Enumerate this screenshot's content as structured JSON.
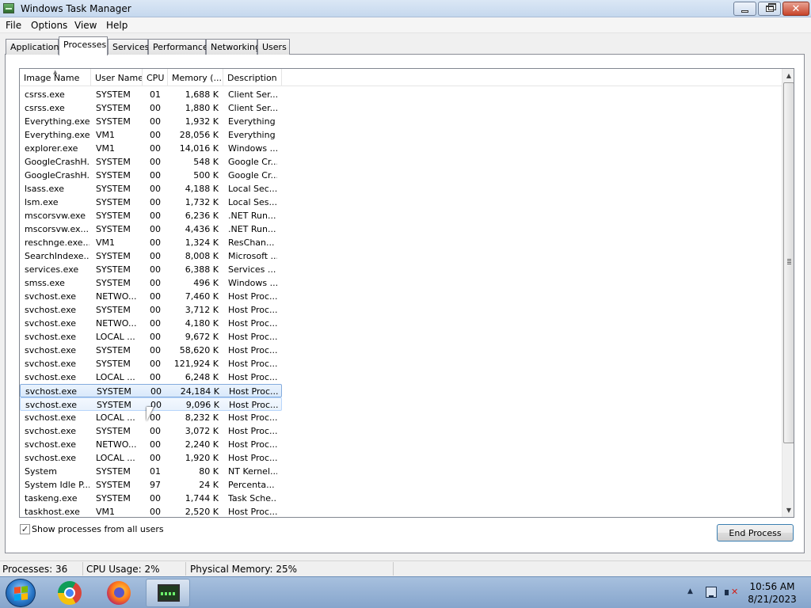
{
  "window": {
    "title": "Windows Task Manager",
    "controls": {
      "minimize": "minimize",
      "maximize": "maximize",
      "close": "✕"
    }
  },
  "menu": [
    "File",
    "Options",
    "View",
    "Help"
  ],
  "tabs": [
    {
      "label": "Applications",
      "active": false
    },
    {
      "label": "Processes",
      "active": true
    },
    {
      "label": "Services",
      "active": false
    },
    {
      "label": "Performance",
      "active": false
    },
    {
      "label": "Networking",
      "active": false
    },
    {
      "label": "Users",
      "active": false
    }
  ],
  "table": {
    "columns": [
      "Image Name",
      "User Name",
      "CPU",
      "Memory (...",
      "Description"
    ],
    "sort_column": "Image Name",
    "rows": [
      [
        "csrss.exe",
        "SYSTEM",
        "01",
        "1,688 K",
        "Client Ser..."
      ],
      [
        "csrss.exe",
        "SYSTEM",
        "00",
        "1,880 K",
        "Client Ser..."
      ],
      [
        "Everything.exe",
        "SYSTEM",
        "00",
        "1,932 K",
        "Everything"
      ],
      [
        "Everything.exe",
        "VM1",
        "00",
        "28,056 K",
        "Everything"
      ],
      [
        "explorer.exe",
        "VM1",
        "00",
        "14,016 K",
        "Windows ..."
      ],
      [
        "GoogleCrashH...",
        "SYSTEM",
        "00",
        "548 K",
        "Google Cr..."
      ],
      [
        "GoogleCrashH...",
        "SYSTEM",
        "00",
        "500 K",
        "Google Cr..."
      ],
      [
        "lsass.exe",
        "SYSTEM",
        "00",
        "4,188 K",
        "Local Sec..."
      ],
      [
        "lsm.exe",
        "SYSTEM",
        "00",
        "1,732 K",
        "Local Ses..."
      ],
      [
        "mscorsvw.exe",
        "SYSTEM",
        "00",
        "6,236 K",
        ".NET Run..."
      ],
      [
        "mscorsvw.ex...",
        "SYSTEM",
        "00",
        "4,436 K",
        ".NET Run..."
      ],
      [
        "reschnge.exe...",
        "VM1",
        "00",
        "1,324 K",
        "ResChan..."
      ],
      [
        "SearchIndexe...",
        "SYSTEM",
        "00",
        "8,008 K",
        "Microsoft ..."
      ],
      [
        "services.exe",
        "SYSTEM",
        "00",
        "6,388 K",
        "Services ..."
      ],
      [
        "smss.exe",
        "SYSTEM",
        "00",
        "496 K",
        "Windows ..."
      ],
      [
        "svchost.exe",
        "NETWO...",
        "00",
        "7,460 K",
        "Host Proc..."
      ],
      [
        "svchost.exe",
        "SYSTEM",
        "00",
        "3,712 K",
        "Host Proc..."
      ],
      [
        "svchost.exe",
        "NETWO...",
        "00",
        "4,180 K",
        "Host Proc..."
      ],
      [
        "svchost.exe",
        "LOCAL ...",
        "00",
        "9,672 K",
        "Host Proc..."
      ],
      [
        "svchost.exe",
        "SYSTEM",
        "00",
        "58,620 K",
        "Host Proc..."
      ],
      [
        "svchost.exe",
        "SYSTEM",
        "00",
        "121,924 K",
        "Host Proc..."
      ],
      [
        "svchost.exe",
        "LOCAL ...",
        "00",
        "6,248 K",
        "Host Proc..."
      ],
      [
        "svchost.exe",
        "SYSTEM",
        "00",
        "24,184 K",
        "Host Proc..."
      ],
      [
        "svchost.exe",
        "SYSTEM",
        "00",
        "9,096 K",
        "Host Proc..."
      ],
      [
        "svchost.exe",
        "LOCAL ...",
        "00",
        "8,232 K",
        "Host Proc..."
      ],
      [
        "svchost.exe",
        "SYSTEM",
        "00",
        "3,072 K",
        "Host Proc..."
      ],
      [
        "svchost.exe",
        "NETWO...",
        "00",
        "2,240 K",
        "Host Proc..."
      ],
      [
        "svchost.exe",
        "LOCAL ...",
        "00",
        "1,920 K",
        "Host Proc..."
      ],
      [
        "System",
        "SYSTEM",
        "01",
        "80 K",
        "NT Kernel..."
      ],
      [
        "System Idle P...",
        "SYSTEM",
        "97",
        "24 K",
        "Percenta..."
      ],
      [
        "taskeng.exe",
        "SYSTEM",
        "00",
        "1,744 K",
        "Task Sche..."
      ],
      [
        "taskhost.exe",
        "VM1",
        "00",
        "2,520 K",
        "Host Proc..."
      ]
    ],
    "selected_row": 22,
    "hover_row": 23
  },
  "show_all_users": {
    "label": "Show processes from all users",
    "checked": true
  },
  "end_process_label": "End Process",
  "status": {
    "processes": "Processes: 36",
    "cpu": "CPU Usage: 2%",
    "memory": "Physical Memory: 25%"
  },
  "taskbar": {
    "items": [
      "start-button",
      "chrome-icon",
      "firefox-icon",
      "task-manager-icon"
    ],
    "clock_time": "10:56 AM",
    "clock_date": "8/21/2023"
  }
}
